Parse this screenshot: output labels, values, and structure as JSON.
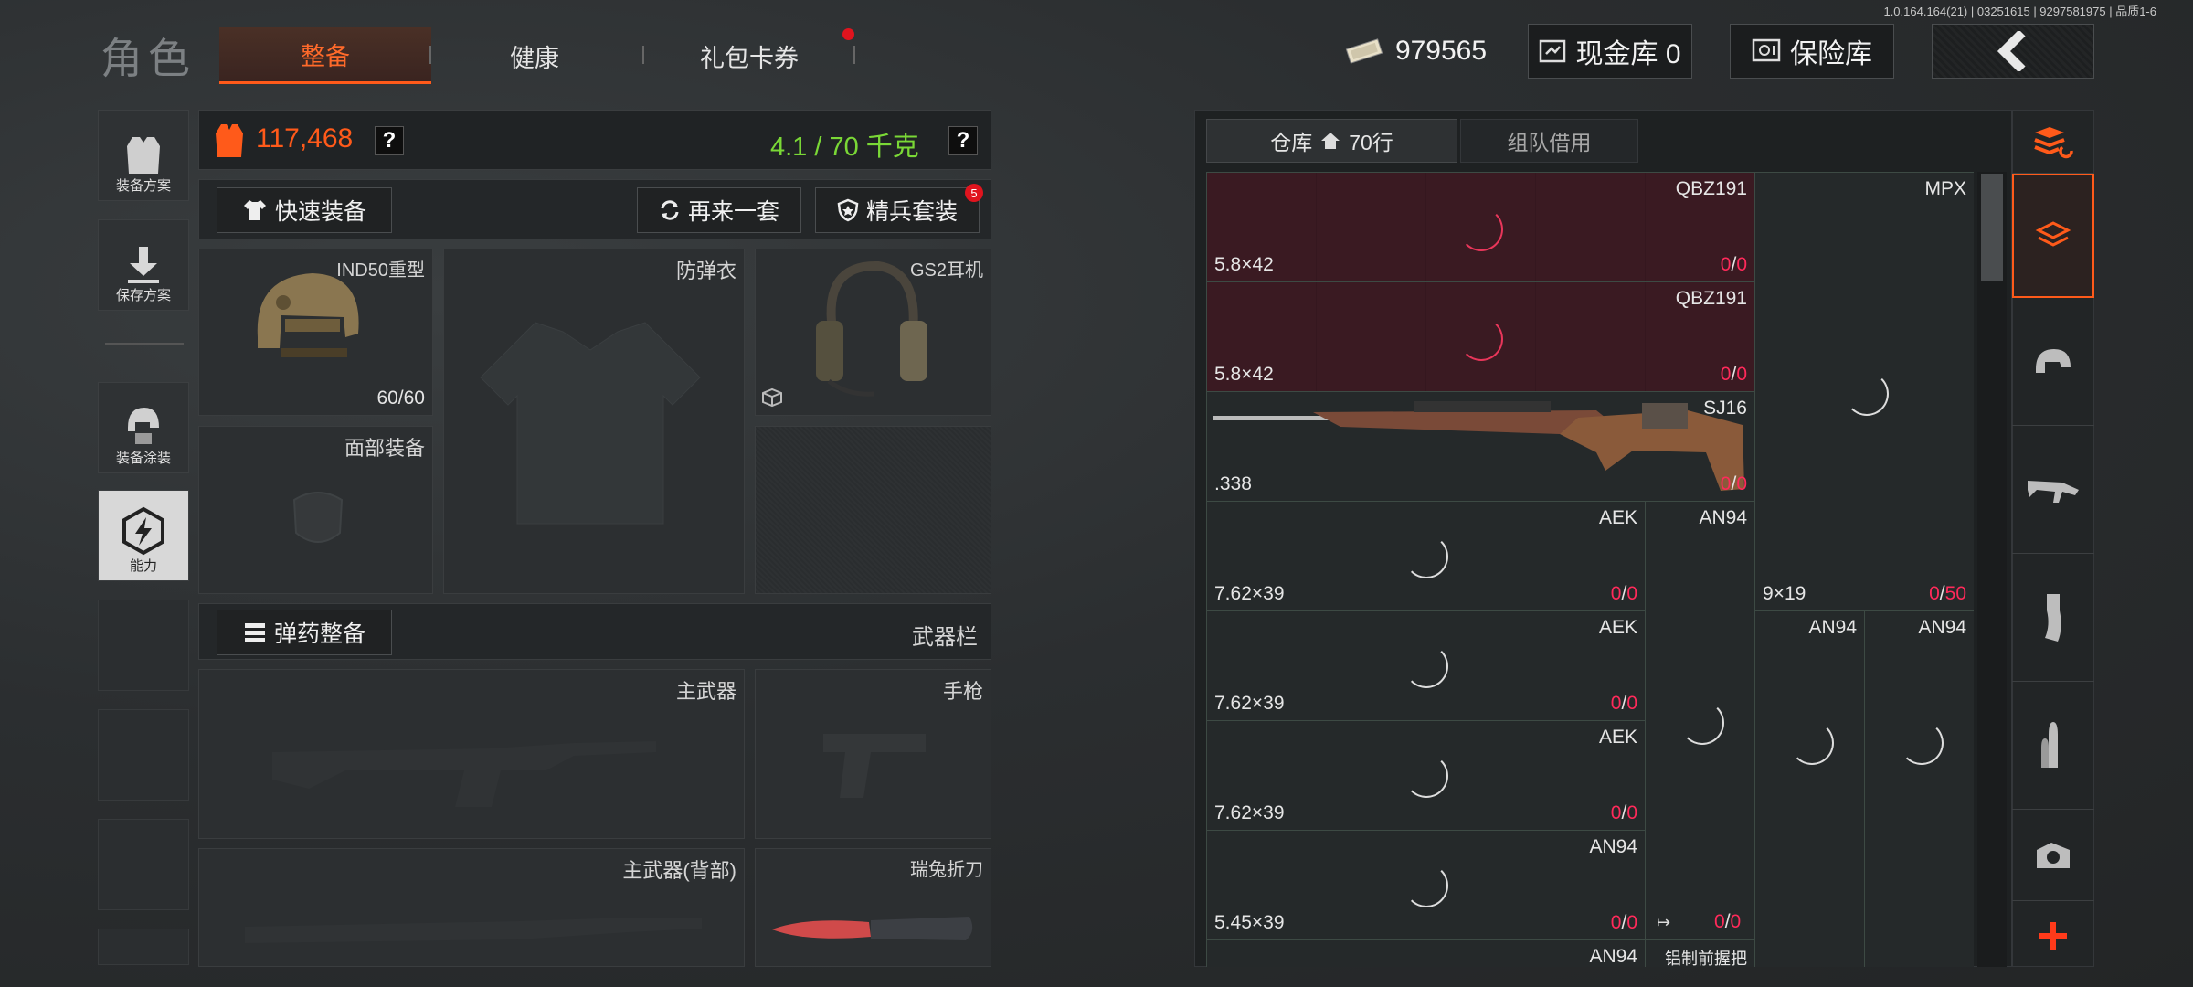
{
  "version": "1.0.164.164(21) | 03251615 | 9297581975 | 品质1-6",
  "header": {
    "title": "角色",
    "tabs": [
      "整备",
      "健康",
      "礼包卡券"
    ],
    "money": "979565",
    "cash_vault": "现金库 0",
    "safe": "保险库"
  },
  "sidebar": [
    "装备方案",
    "保存方案",
    "装备涂装",
    "能力"
  ],
  "loadout": {
    "value": "117,468",
    "weight": "4.1 / 70 千克",
    "help": "?",
    "quick_equip": "快速装备",
    "repeat": "再来一套",
    "elite": "精兵套装",
    "elite_badge": "5",
    "helmet": "IND50重型",
    "helmet_dur": "60/60",
    "armor": "防弹衣",
    "headset": "GS2耳机",
    "face": "面部装备",
    "ammo_equip": "弹药整备",
    "weapon_bar": "武器栏",
    "primary": "主武器",
    "pistol": "手枪",
    "primary_back": "主武器(背部)",
    "knife": "瑞兔折刀"
  },
  "storage": {
    "tab_warehouse": "仓库",
    "rows": "70行",
    "tab_team": "组队借用",
    "items": [
      {
        "name": "QBZ191",
        "cal": "5.8×42",
        "cur": "0",
        "max": "0"
      },
      {
        "name": "QBZ191",
        "cal": "5.8×42",
        "cur": "0",
        "max": "0"
      },
      {
        "name": "SJ16",
        "cal": ".338",
        "cur": "0",
        "max": "0"
      },
      {
        "name": "AEK",
        "cal": "7.62×39",
        "cur": "0",
        "max": "0"
      },
      {
        "name": "AEK",
        "cal": "7.62×39",
        "cur": "0",
        "max": "0"
      },
      {
        "name": "AEK",
        "cal": "7.62×39",
        "cur": "0",
        "max": "0"
      },
      {
        "name": "AN94",
        "cal": "5.45×39",
        "cur": "0",
        "max": "0"
      },
      {
        "name": "MPX",
        "cal": "9×19",
        "cur": "0",
        "max": "50"
      },
      {
        "name": "AN94"
      },
      {
        "name": "AN94"
      },
      {
        "name": "AN94"
      },
      {
        "name": "AN94"
      },
      {
        "name": "铝制前握把",
        "cur": "0",
        "max": "0"
      }
    ]
  },
  "colors": {
    "accent": "#ff5a1a",
    "weight_ok": "#7ad836",
    "ammo_empty": "#ff2a5a"
  }
}
